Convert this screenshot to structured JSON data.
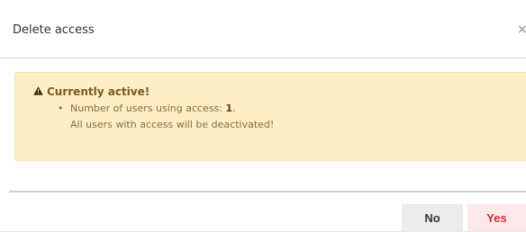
{
  "dialog": {
    "title": "Delete access",
    "close_symbol": "×"
  },
  "alert": {
    "icon": "warning-icon",
    "heading": "Currently active!",
    "bullet": "•",
    "line1_prefix": "Number of users using access:",
    "line1_count": "1",
    "line1_suffix": ".",
    "line2": "All users with access will be deactivated!",
    "colors": {
      "background": "#fcefc5",
      "text": "#8a6d3b"
    }
  },
  "footer": {
    "no_label": "No",
    "yes_label": "Yes",
    "colors": {
      "yes_text": "#e02a35",
      "yes_background": "#fde9ea",
      "no_background": "#ececec"
    }
  }
}
